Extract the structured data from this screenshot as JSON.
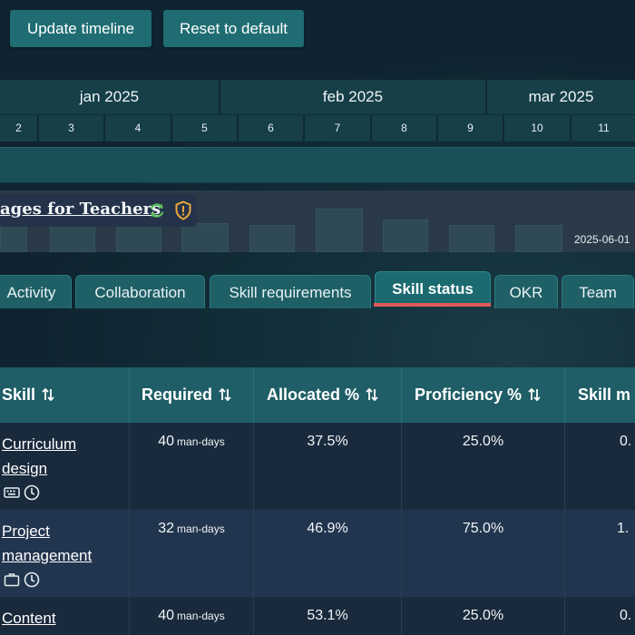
{
  "toolbar": {
    "update_label": "Update timeline",
    "reset_label": "Reset to default"
  },
  "timeline": {
    "months": [
      "jan 2025",
      "feb 2025",
      "mar 2025"
    ],
    "days": [
      "2",
      "3",
      "4",
      "5",
      "6",
      "7",
      "8",
      "9",
      "10",
      "11"
    ]
  },
  "project": {
    "title": "ages for Teachers",
    "date": "2025-06-01",
    "sync_icon": "sync-icon",
    "status_icon": "shield-alert-icon"
  },
  "tabs": [
    {
      "label": "Activity"
    },
    {
      "label": "Collaboration"
    },
    {
      "label": "Skill requirements"
    },
    {
      "label": "Skill status",
      "active": true
    },
    {
      "label": "OKR"
    },
    {
      "label": "Team"
    }
  ],
  "table": {
    "headers": [
      "Skill",
      "Required",
      "Allocated %",
      "Proficiency %",
      "Skill m"
    ],
    "unit": "man-days",
    "rows": [
      {
        "skill_line1": "Curriculum",
        "skill_line2": "design",
        "required": "40",
        "allocated": "37.5%",
        "proficiency": "25.0%",
        "skill_m": "0.",
        "icons": [
          "keyboard-icon",
          "clock-icon"
        ]
      },
      {
        "skill_line1": "Project",
        "skill_line2": "management",
        "required": "32",
        "allocated": "46.9%",
        "proficiency": "75.0%",
        "skill_m": "1.",
        "icons": [
          "briefcase-icon",
          "clock-icon"
        ]
      },
      {
        "skill_line1": "Content",
        "skill_line2": "",
        "required": "40",
        "allocated": "53.1%",
        "proficiency": "25.0%",
        "skill_m": "0.",
        "icons": []
      }
    ]
  },
  "colors": {
    "accent": "#1f6d73",
    "active_tab_underline": "#e05a5a",
    "sync_green": "#5cc05a",
    "shield_orange": "#e8a93a"
  }
}
